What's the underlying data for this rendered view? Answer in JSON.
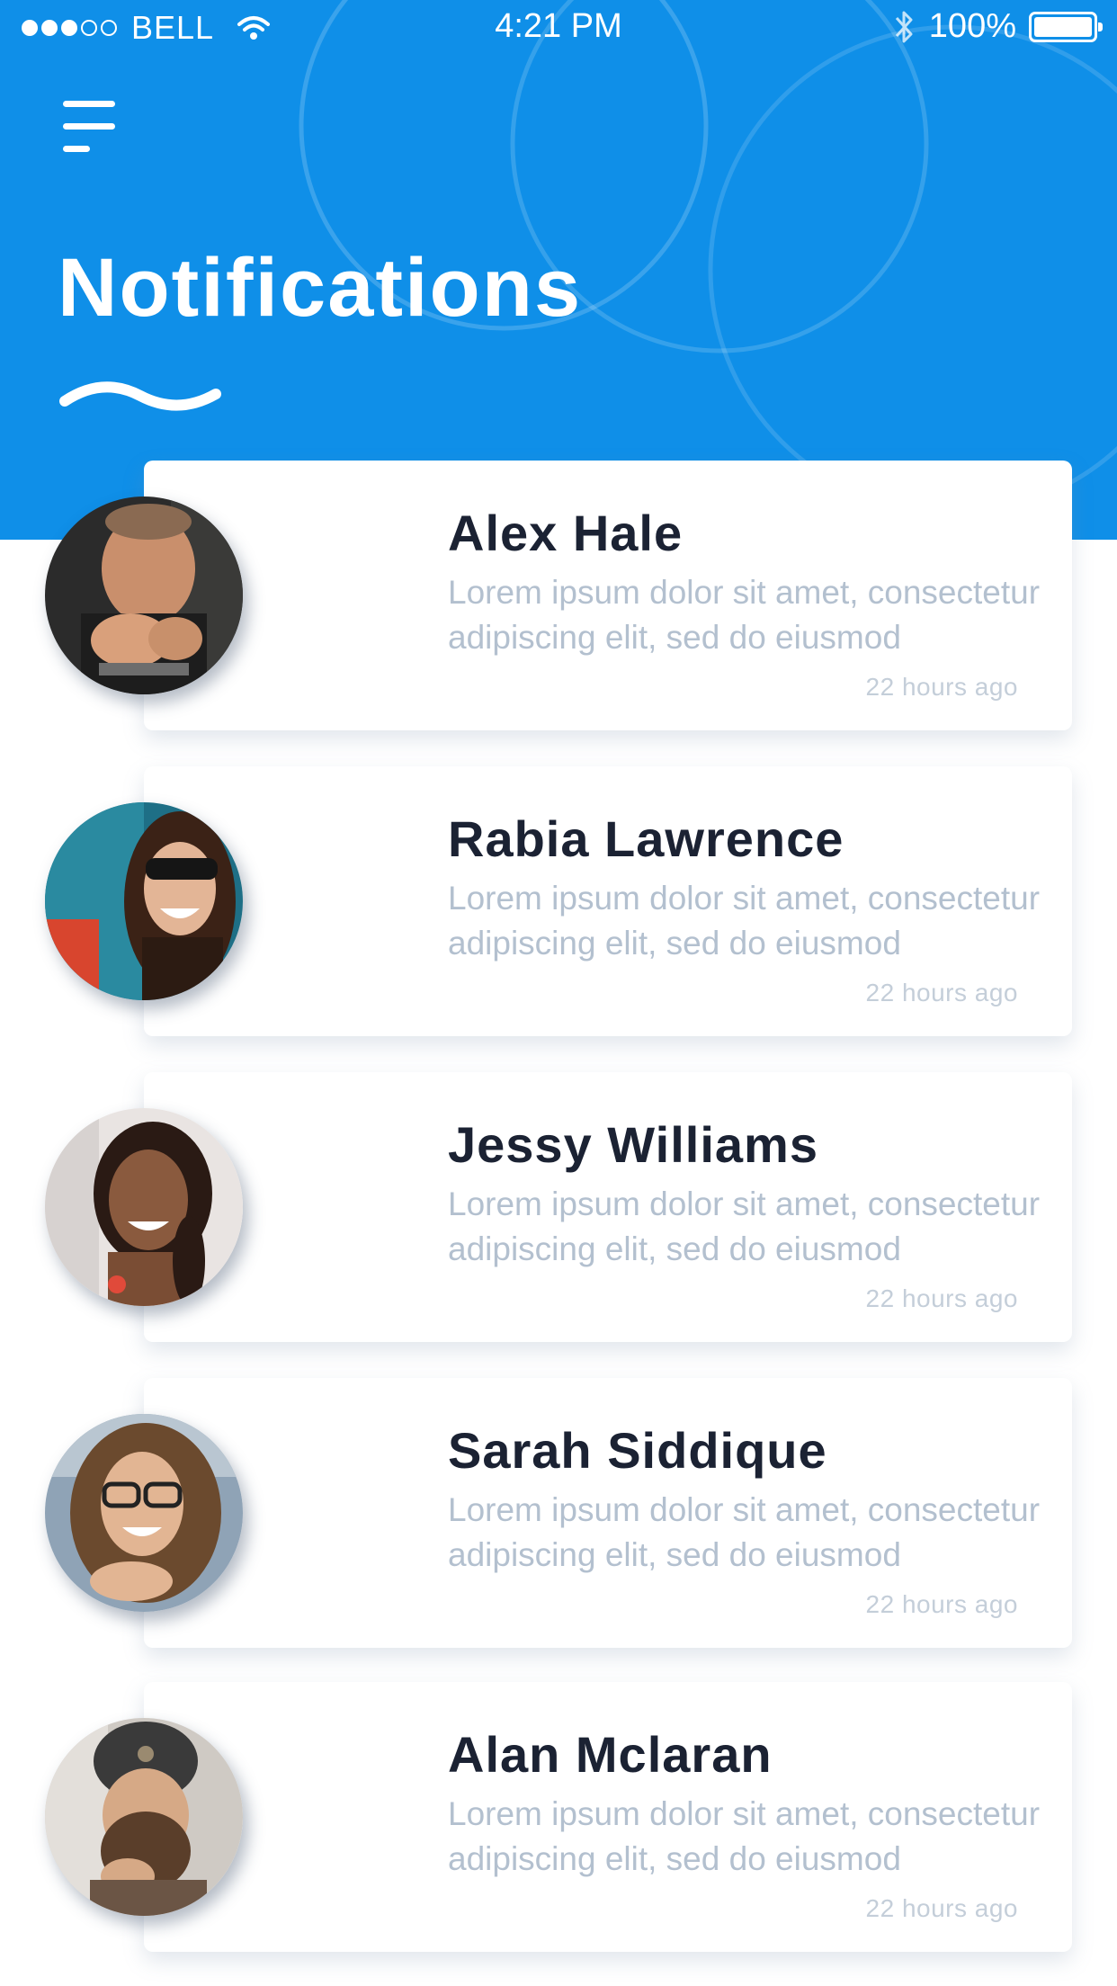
{
  "status_bar": {
    "carrier": "BELL",
    "time": "4:21 PM",
    "battery": "100%"
  },
  "header": {
    "title": "Notifications"
  },
  "colors": {
    "header_bg": "#0f8fe8",
    "name_text": "#1b2233",
    "message_text": "#b3c0cf",
    "time_text": "#c4ced9"
  },
  "notifications": [
    {
      "name": "Alex Hale",
      "message": "Lorem ipsum dolor sit amet, consectetur adipiscing elit, sed do eiusmod",
      "time": "22 hours ago"
    },
    {
      "name": "Rabia Lawrence",
      "message": "Lorem ipsum dolor sit amet, consectetur adipiscing elit, sed do eiusmod",
      "time": "22 hours ago"
    },
    {
      "name": "Jessy Williams",
      "message": "Lorem ipsum dolor sit amet, consectetur adipiscing elit, sed do eiusmod",
      "time": "22 hours ago"
    },
    {
      "name": "Sarah Siddique",
      "message": "Lorem ipsum dolor sit amet, consectetur adipiscing elit, sed do eiusmod",
      "time": "22 hours ago"
    },
    {
      "name": "Alan Mclaran",
      "message": "Lorem ipsum dolor sit amet, consectetur adipiscing elit, sed do eiusmod",
      "time": "22 hours ago"
    }
  ]
}
